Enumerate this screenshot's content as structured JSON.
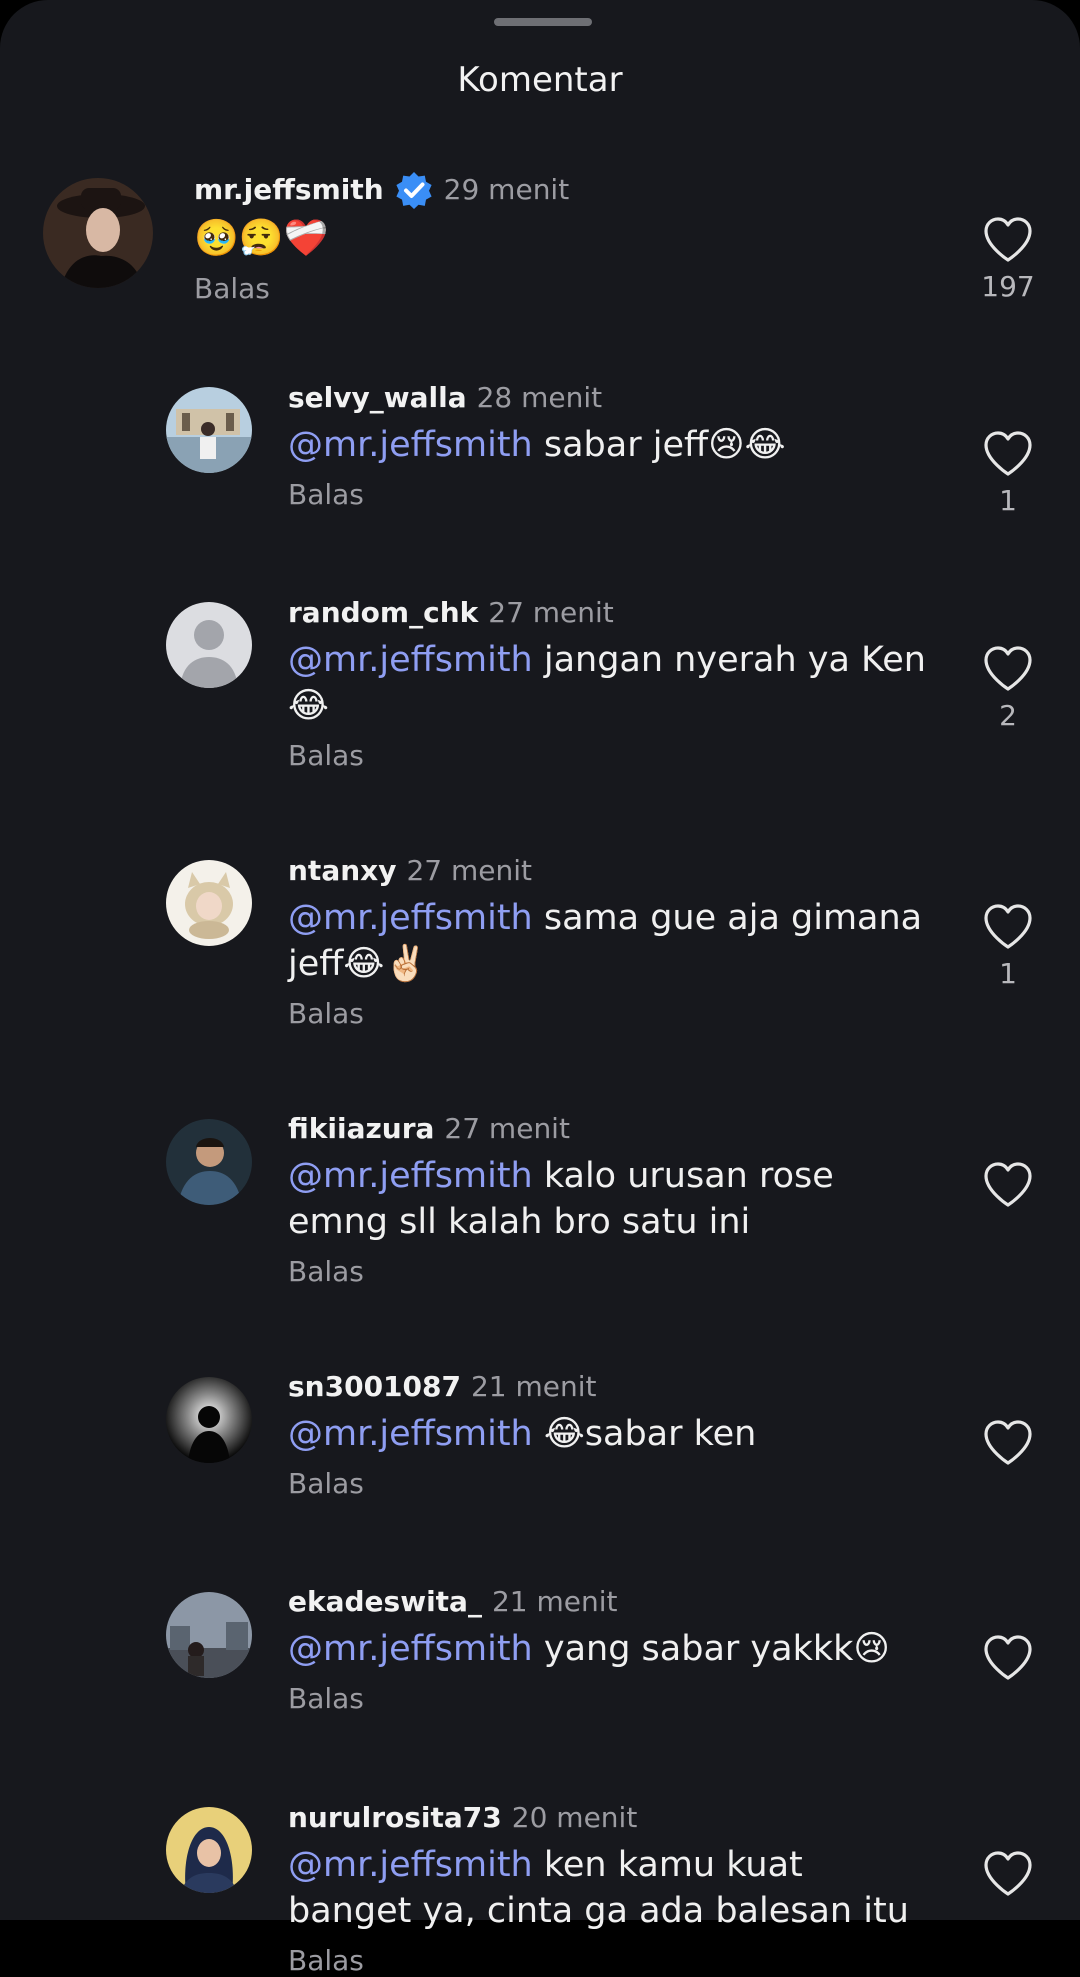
{
  "header": {
    "title": "Komentar"
  },
  "comments": [
    {
      "username": "mr.jeffsmith",
      "verified": true,
      "time": "29 menit",
      "mention": "",
      "text": "🥹😮‍💨❤️‍🩹",
      "reply_label": "Balas",
      "likes": "197"
    },
    {
      "username": "selvy_walla",
      "time": "28 menit",
      "mention": "@mr.jeffsmith",
      "text": " sabar jeff😢😂",
      "reply_label": "Balas",
      "likes": "1"
    },
    {
      "username": "random_chk",
      "time": "27 menit",
      "mention": "@mr.jeffsmith",
      "text": " jangan nyerah ya Ken 😂",
      "reply_label": "Balas",
      "likes": "2"
    },
    {
      "username": "ntanxy",
      "time": "27 menit",
      "mention": "@mr.jeffsmith",
      "text": " sama gue aja gimana jeff😂✌🏻",
      "reply_label": "Balas",
      "likes": "1"
    },
    {
      "username": "fikiiazura",
      "time": "27 menit",
      "mention": "@mr.jeffsmith",
      "text": " kalo urusan rose emng sll kalah bro satu ini",
      "reply_label": "Balas",
      "likes": ""
    },
    {
      "username": "sn3001087",
      "time": "21 menit",
      "mention": "@mr.jeffsmith",
      "text": " 😂sabar ken",
      "reply_label": "Balas",
      "likes": ""
    },
    {
      "username": "ekadeswita_",
      "time": "21 menit",
      "mention": "@mr.jeffsmith",
      "text": " yang sabar yakkk😢",
      "reply_label": "Balas",
      "likes": ""
    },
    {
      "username": "nurulrosita73",
      "time": "20 menit",
      "mention": "@mr.jeffsmith",
      "text": " ken kamu kuat banget ya, cinta ga ada balesan itu",
      "reply_label": "Balas",
      "likes": ""
    }
  ],
  "colors": {
    "background": "#17181d",
    "mention": "#8f9ef2",
    "verified": "#3a8ef6",
    "muted": "#9c9ca2"
  }
}
